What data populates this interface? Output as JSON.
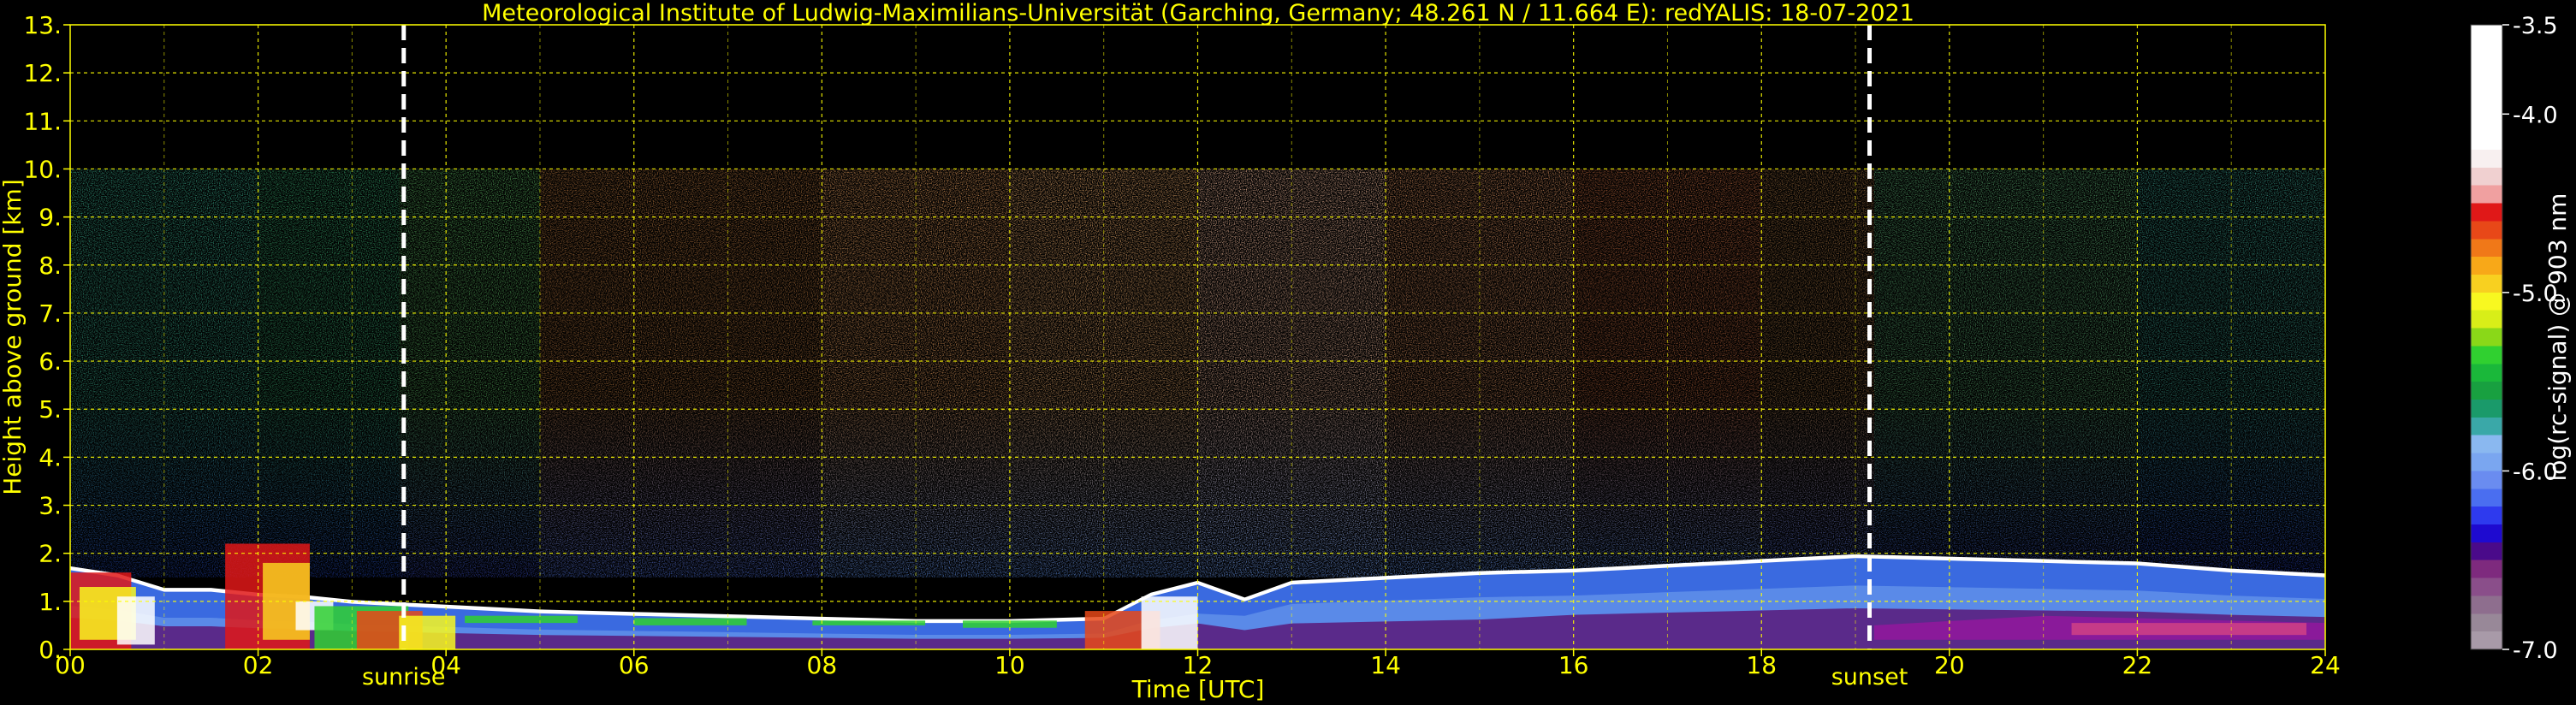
{
  "chart_data": {
    "type": "heatmap",
    "title": "Meteorological Institute of Ludwig-Maximilians-Universität (Garching, Germany; 48.261 N / 11.664 E):    redYALIS: 18-07-2021",
    "xlabel": "Time [UTC]",
    "ylabel": "Height above ground [km]",
    "xlim": [
      0,
      24
    ],
    "ylim": [
      0,
      13
    ],
    "xticks": [
      "00",
      "02",
      "04",
      "06",
      "08",
      "10",
      "12",
      "14",
      "16",
      "18",
      "20",
      "22",
      "24"
    ],
    "yticks": [
      "0.",
      "1.",
      "2.",
      "3.",
      "4.",
      "5.",
      "6.",
      "7.",
      "8.",
      "9.",
      "10.",
      "11.",
      "12.",
      "13."
    ],
    "grid": true,
    "events": [
      {
        "label": "sunrise",
        "time": 3.55
      },
      {
        "label": "sunset",
        "time": 19.15
      }
    ],
    "colorbar": {
      "label": "log(rc-signal) @ 903 nm",
      "range": [
        -7.0,
        -3.5
      ],
      "ticks": [
        "-3.5",
        "-4.0",
        "-5.0",
        "-6.0",
        "-7.0"
      ],
      "tick_values": [
        -3.5,
        -4.0,
        -5.0,
        -6.0,
        -7.0
      ],
      "colors": [
        "#a89aa8",
        "#988898",
        "#8e6e8e",
        "#8a4e8a",
        "#7e2a7e",
        "#4a0a8a",
        "#1e0ad0",
        "#2e3aee",
        "#4a6ef0",
        "#6a8cf0",
        "#7aa6f0",
        "#8ab8f0",
        "#3aa8a8",
        "#1a9a6a",
        "#18a040",
        "#1ab83a",
        "#30d030",
        "#8ad818",
        "#d8ee18",
        "#f8f820",
        "#f8d020",
        "#f8a818",
        "#f07818",
        "#e84818",
        "#e01818",
        "#f0a0a0",
        "#f0d0d0",
        "#f8f0f0",
        "#ffffff",
        "#ffffff",
        "#ffffff",
        "#ffffff",
        "#ffffff",
        "#ffffff",
        "#ffffff"
      ]
    },
    "boundary_layer": {
      "time": [
        0,
        0.5,
        1.0,
        1.5,
        2.0,
        2.5,
        3.0,
        3.5,
        4.0,
        5.0,
        6.0,
        7.0,
        8.0,
        9.0,
        10.0,
        11.0,
        11.5,
        12.0,
        12.5,
        13.0,
        14.0,
        15.0,
        16.0,
        17.0,
        18.0,
        19.0,
        20.0,
        21.0,
        22.0,
        23.0,
        24.0
      ],
      "top_km": [
        1.65,
        1.5,
        1.2,
        1.2,
        1.1,
        1.05,
        0.95,
        0.9,
        0.85,
        0.75,
        0.7,
        0.65,
        0.6,
        0.55,
        0.55,
        0.6,
        1.1,
        1.35,
        1.0,
        1.35,
        1.45,
        1.55,
        1.6,
        1.7,
        1.8,
        1.9,
        1.85,
        1.8,
        1.75,
        1.6,
        1.5
      ]
    }
  }
}
